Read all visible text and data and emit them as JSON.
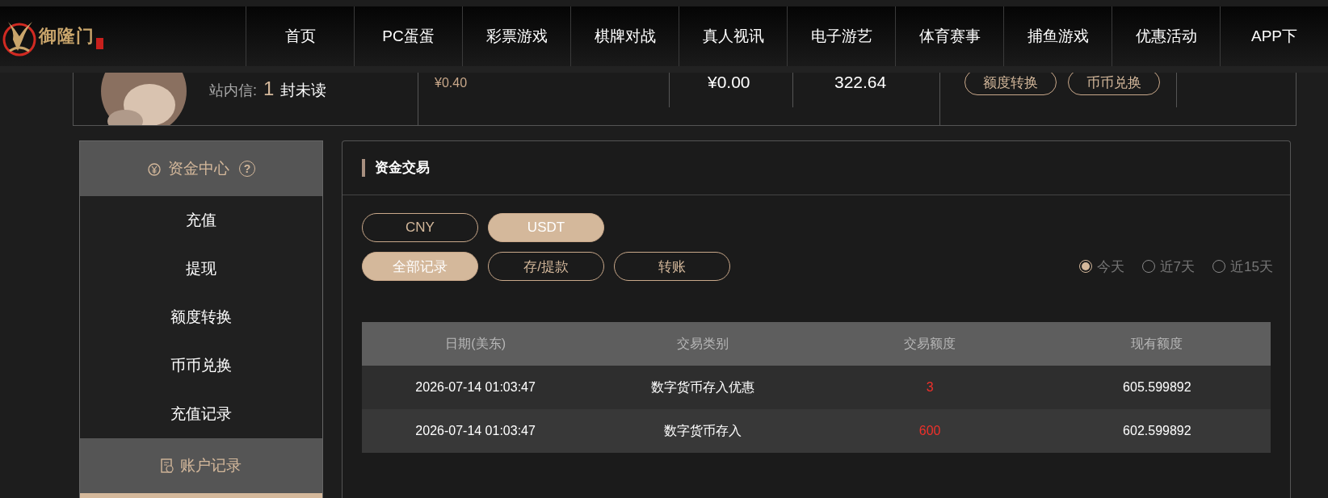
{
  "logo": {
    "name": "御隆门"
  },
  "nav": [
    {
      "label": "首页"
    },
    {
      "label": "PC蛋蛋"
    },
    {
      "label": "彩票游戏"
    },
    {
      "label": "棋牌对战"
    },
    {
      "label": "真人视讯"
    },
    {
      "label": "电子游艺"
    },
    {
      "label": "体育赛事"
    },
    {
      "label": "捕鱼游戏"
    },
    {
      "label": "优惠活动"
    },
    {
      "label": "APP下"
    }
  ],
  "account": {
    "message_label": "站内信:",
    "unread_count": "1",
    "unread_suffix": "封未读",
    "balances": [
      "¥0.40",
      "¥0.00",
      "322.64"
    ],
    "buttons": [
      "额度转换",
      "币币兑换"
    ]
  },
  "sidebar": {
    "sections": [
      {
        "kind": "funds",
        "title": "资金中心",
        "help": "?",
        "items": [
          "充值",
          "提现",
          "额度转换",
          "币币兑换",
          "充值记录"
        ]
      },
      {
        "kind": "records",
        "title": "账户记录"
      }
    ]
  },
  "panel": {
    "title": "资金交易",
    "currency_tabs": [
      {
        "label": "CNY",
        "selected": false
      },
      {
        "label": "USDT",
        "selected": true
      }
    ],
    "record_tabs": [
      {
        "label": "全部记录",
        "selected": true
      },
      {
        "label": "存/提款",
        "selected": false
      },
      {
        "label": "转账",
        "selected": false
      }
    ],
    "date_filters": [
      {
        "label": "今天",
        "selected": true
      },
      {
        "label": "近7天",
        "selected": false
      },
      {
        "label": "近15天",
        "selected": false
      }
    ],
    "table": {
      "columns": [
        "日期(美东)",
        "交易类别",
        "交易额度",
        "现有额度"
      ],
      "rows": [
        {
          "date": "2026-07-14 01:03:47",
          "type": "数字货币存入优惠",
          "amount": "3",
          "balance": "605.599892"
        },
        {
          "date": "2026-07-14 01:03:47",
          "type": "数字货币存入",
          "amount": "600",
          "balance": "602.599892"
        }
      ]
    }
  }
}
